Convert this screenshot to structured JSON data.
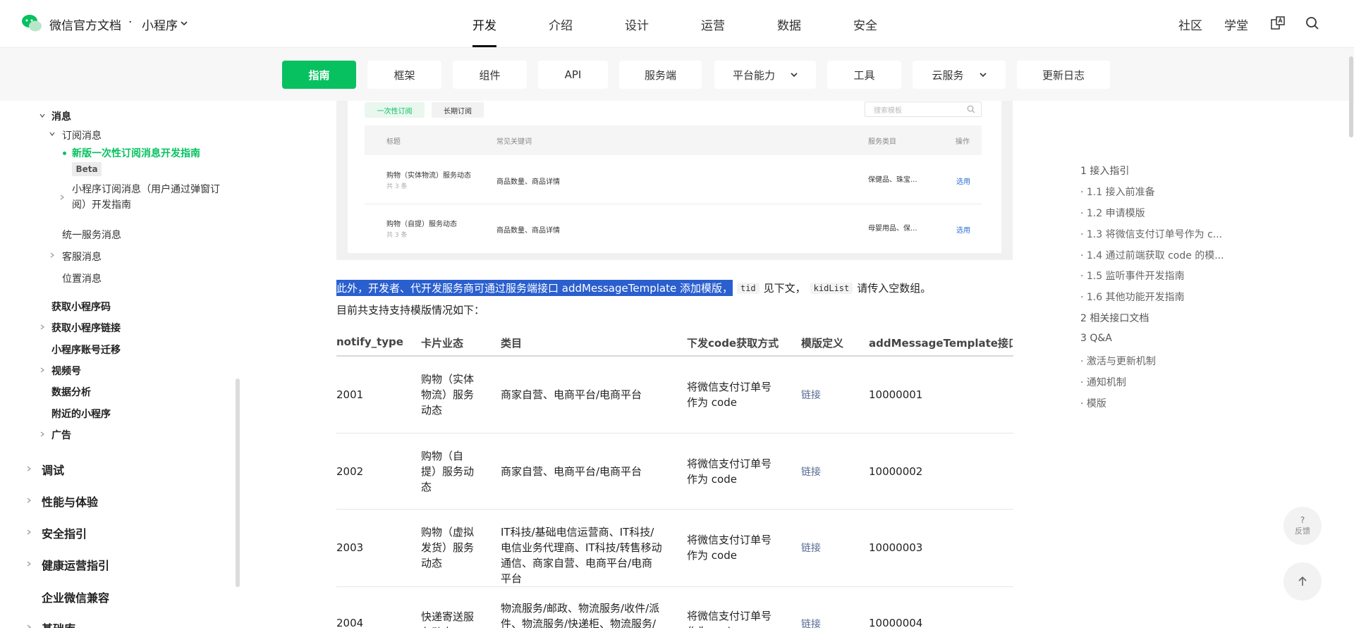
{
  "header": {
    "brand": "微信官方文档",
    "separator": "·",
    "product": "小程序",
    "nav": [
      "开发",
      "介绍",
      "设计",
      "运营",
      "数据",
      "安全"
    ],
    "right_links": [
      "社区",
      "学堂"
    ]
  },
  "subnav": {
    "tabs": [
      {
        "label": "指南"
      },
      {
        "label": "框架"
      },
      {
        "label": "组件"
      },
      {
        "label": "API"
      },
      {
        "label": "服务端"
      },
      {
        "label": "平台能力"
      },
      {
        "label": "工具"
      },
      {
        "label": "云服务"
      },
      {
        "label": "更新日志"
      }
    ]
  },
  "sidebar": {
    "items": [
      "消息",
      "订阅消息",
      "新版一次性订阅消息开发指南",
      "Beta",
      "小程序订阅消息（用户通过弹窗订阅）开发指南",
      "统一服务消息",
      "客服消息",
      "位置消息",
      "获取小程序码",
      "获取小程序链接",
      "小程序账号迁移",
      "视频号",
      "数据分析",
      "附近的小程序",
      "广告",
      "调试",
      "性能与体验",
      "安全指引",
      "健康运营指引",
      "企业微信兼容",
      "基础库"
    ]
  },
  "figure": {
    "tab_once": "一次性订阅",
    "tab_long": "长期订阅",
    "search_placeholder": "搜索模板",
    "headers": [
      "标题",
      "常见关键词",
      "服务类目",
      "操作"
    ],
    "rows": [
      {
        "title": "购物（实体物流）服务动态",
        "sub": "共 3 条",
        "keywords": "商品数量、商品详情",
        "category": "保健品、珠宝...",
        "action": "选用"
      },
      {
        "title": "购物（自提）服务动态",
        "sub": "共 3 条",
        "keywords": "商品数量、商品详情",
        "category": "母婴用品、保...",
        "action": "选用"
      }
    ]
  },
  "content": {
    "para_highlight": "此外，开发者、代开发服务商可通过服务端接口 addMessageTemplate 添加模版，",
    "code1": "tid",
    "para_mid": "见下文，",
    "code2": "kidList",
    "para_end": "请传入空数组。",
    "para2": "目前共支持支持模版情况如下：",
    "table": {
      "headers": [
        "notify_type",
        "卡片业态",
        "类目",
        "下发code获取方式",
        "模版定义",
        "addMessageTemplate接口 tid"
      ],
      "rows": [
        {
          "type": "2001",
          "biz": "购物（实体物流）服务动态",
          "category": "商家自营、电商平台/电商平台",
          "code": "将微信支付订单号作为 code",
          "def": "链接",
          "tid": "10000001"
        },
        {
          "type": "2002",
          "biz": "购物（自提）服务动态",
          "category": "商家自营、电商平台/电商平台",
          "code": "将微信支付订单号作为 code",
          "def": "链接",
          "tid": "10000002"
        },
        {
          "type": "2003",
          "biz": "购物（虚拟发货）服务动态",
          "category": "IT科技/基础电信运营商、IT科技/电信业务代理商、IT科技/转售移动通信、商家自营、电商平台/电商平台",
          "code": "将微信支付订单号作为 code",
          "def": "链接",
          "tid": "10000003"
        },
        {
          "type": "2004",
          "biz": "快递寄送服务动态",
          "category": "物流服务/邮政、物流服务/收件/派件、物流服务/快递柜、物流服务/货",
          "code": "将微信支付订单号作为 code",
          "def": "链接",
          "tid": "10000004"
        }
      ]
    }
  },
  "toc": [
    "1 接入指引",
    "· 1.1 接入前准备",
    "· 1.2 申请模版",
    "· 1.3 将微信支付订单号作为 c...",
    "· 1.4 通过前端获取 code 的模...",
    "· 1.5 监听事件开发指南",
    "· 1.6 其他功能开发指南",
    "2 相关接口文档",
    "3 Q&A",
    "· 激活与更新机制",
    "· 通知机制",
    "· 模版"
  ],
  "fab": {
    "feedback_q": "?",
    "feedback": "反馈"
  },
  "colors": {
    "accent": "#07c160",
    "highlight": "#2a5fcf",
    "link": "#576b95"
  }
}
